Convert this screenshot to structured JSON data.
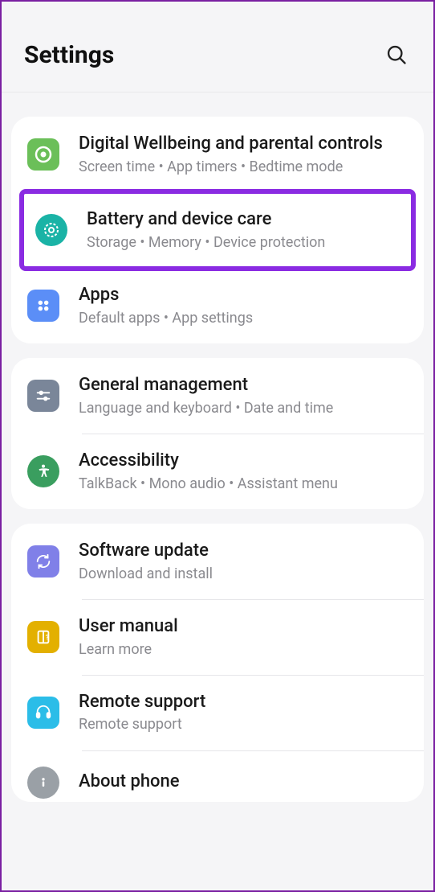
{
  "header": {
    "title": "Settings"
  },
  "sections": [
    {
      "items": [
        {
          "title": "Digital Wellbeing and parental controls",
          "subtitle": "Screen time  •  App timers  •  Bedtime mode"
        },
        {
          "title": "Battery and device care",
          "subtitle": "Storage  •  Memory  •  Device protection",
          "highlighted": true
        },
        {
          "title": "Apps",
          "subtitle": "Default apps  •  App settings"
        }
      ]
    },
    {
      "items": [
        {
          "title": "General management",
          "subtitle": "Language and keyboard  •  Date and time"
        },
        {
          "title": "Accessibility",
          "subtitle": "TalkBack  •  Mono audio  •  Assistant menu"
        }
      ]
    },
    {
      "items": [
        {
          "title": "Software update",
          "subtitle": "Download and install"
        },
        {
          "title": "User manual",
          "subtitle": "Learn more"
        },
        {
          "title": "Remote support",
          "subtitle": "Remote support"
        },
        {
          "title": "About phone",
          "subtitle": ""
        }
      ]
    }
  ]
}
